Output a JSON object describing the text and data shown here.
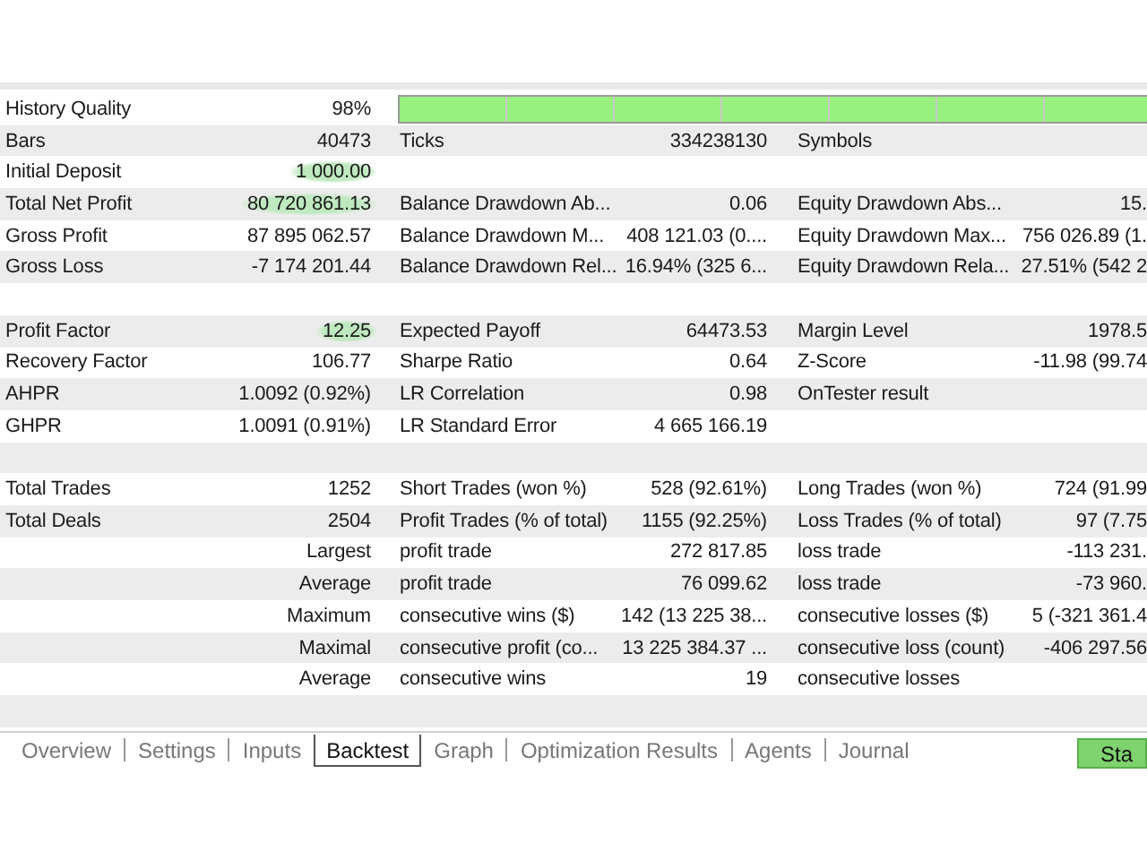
{
  "rows": [
    {
      "kind": "quality",
      "cells": [
        {
          "label": "History Quality",
          "value": "98%"
        }
      ],
      "level": 1
    },
    {
      "kind": "stats",
      "cells": [
        {
          "label": "Bars",
          "value": "40473"
        },
        {
          "label": "Ticks",
          "value": "334238130"
        },
        {
          "label": "Symbols"
        }
      ]
    },
    {
      "kind": "stats",
      "cells": [
        {
          "label": "Initial Deposit",
          "value": "1 000.00",
          "highlighted": true
        }
      ]
    },
    {
      "kind": "stats",
      "cells": [
        {
          "label": "Total Net Profit",
          "value": "80 720 861.13",
          "highlighted": true
        },
        {
          "label": "Balance Drawdown Ab...",
          "value": "0.06"
        },
        {
          "label": "Equity Drawdown Abs...",
          "value": "15."
        }
      ]
    },
    {
      "kind": "stats",
      "cells": [
        {
          "label": "Gross Profit",
          "value": "87 895 062.57",
          "highlighted": false
        },
        {
          "label": "Balance Drawdown M...",
          "value": "408 121.03 (0...."
        },
        {
          "label": "Equity Drawdown Max...",
          "value": "756 026.89 (1."
        }
      ]
    },
    {
      "kind": "stats",
      "cells": [
        {
          "label": "Gross Loss",
          "value": "-7 174 201.44",
          "highlighted": false
        },
        {
          "label": "Balance Drawdown Rel...",
          "value": "16.94% (325 6..."
        },
        {
          "label": "Equity Drawdown Rela...",
          "value": "27.51% (542 2"
        }
      ]
    },
    {
      "kind": "stats",
      "cells": []
    },
    {
      "kind": "stats",
      "cells": [
        {
          "label": "Profit Factor",
          "value": "12.25",
          "highlighted": true
        },
        {
          "label": "Expected Payoff",
          "value": "64473.53"
        },
        {
          "label": "Margin Level",
          "value": "1978.5"
        }
      ]
    },
    {
      "kind": "stats",
      "cells": [
        {
          "label": "Recovery Factor",
          "value": "106.77",
          "highlighted": false
        },
        {
          "label": "Sharpe Ratio",
          "value": "0.64"
        },
        {
          "label": "Z-Score",
          "value": "-11.98 (99.74"
        }
      ]
    },
    {
      "kind": "stats",
      "cells": [
        {
          "label": "AHPR",
          "value": "1.0092 (0.92%)",
          "highlighted": false
        },
        {
          "label": "LR Correlation",
          "value": "0.98"
        },
        {
          "label": "OnTester result"
        }
      ]
    },
    {
      "kind": "stats",
      "cells": [
        {
          "label": "GHPR",
          "value": "1.0091 (0.91%)",
          "highlighted": false
        },
        {
          "label": "LR Standard Error",
          "value": "4 665 166.19"
        }
      ]
    },
    {
      "kind": "stats",
      "cells": []
    },
    {
      "kind": "stats",
      "cells": [
        {
          "label": "Total Trades",
          "value": "1252",
          "highlighted": false
        },
        {
          "label": "Short Trades (won %)",
          "value": "528 (92.61%)"
        },
        {
          "label": "Long Trades (won %)",
          "value": "724 (91.99"
        }
      ]
    },
    {
      "kind": "stats",
      "cells": [
        {
          "label": "Total Deals",
          "value": "2504",
          "highlighted": false
        },
        {
          "label": "Profit Trades (% of total)",
          "value": "1155 (92.25%)"
        },
        {
          "label": "Loss Trades (% of total)",
          "value": "97 (7.75"
        }
      ]
    },
    {
      "kind": "stats",
      "cells": [
        {
          "value": "Largest"
        },
        {
          "label": "profit trade",
          "value": "272 817.85"
        },
        {
          "label": "loss trade",
          "value": "-113 231."
        }
      ]
    },
    {
      "kind": "stats",
      "cells": [
        {
          "value": "Average"
        },
        {
          "label": "profit trade",
          "value": "76 099.62"
        },
        {
          "label": "loss trade",
          "value": "-73 960."
        }
      ]
    },
    {
      "kind": "stats",
      "cells": [
        {
          "value": "Maximum"
        },
        {
          "label": "consecutive wins ($)",
          "value": "142 (13 225 38..."
        },
        {
          "label": "consecutive losses ($)",
          "value": "5 (-321 361.4"
        }
      ]
    },
    {
      "kind": "stats",
      "cells": [
        {
          "value": "Maximal"
        },
        {
          "label": "consecutive profit (co...",
          "value": "13 225 384.37 ..."
        },
        {
          "label": "consecutive loss (count)",
          "value": "-406 297.56"
        }
      ]
    },
    {
      "kind": "stats",
      "cells": [
        {
          "value": "Average"
        },
        {
          "label": "consecutive wins",
          "value": "19"
        },
        {
          "label": "consecutive losses"
        }
      ]
    },
    {
      "kind": "stats",
      "cells": []
    }
  ],
  "tabs": [
    {
      "label": "Overview",
      "selected": false
    },
    {
      "label": "Settings",
      "selected": false
    },
    {
      "label": "Inputs",
      "selected": false
    },
    {
      "label": "Backtest",
      "selected": true
    },
    {
      "label": "Graph",
      "selected": false
    },
    {
      "label": "Optimization Results",
      "selected": false
    },
    {
      "label": "Agents",
      "selected": false
    },
    {
      "label": "Journal",
      "selected": false
    }
  ],
  "start_button": "Sta"
}
